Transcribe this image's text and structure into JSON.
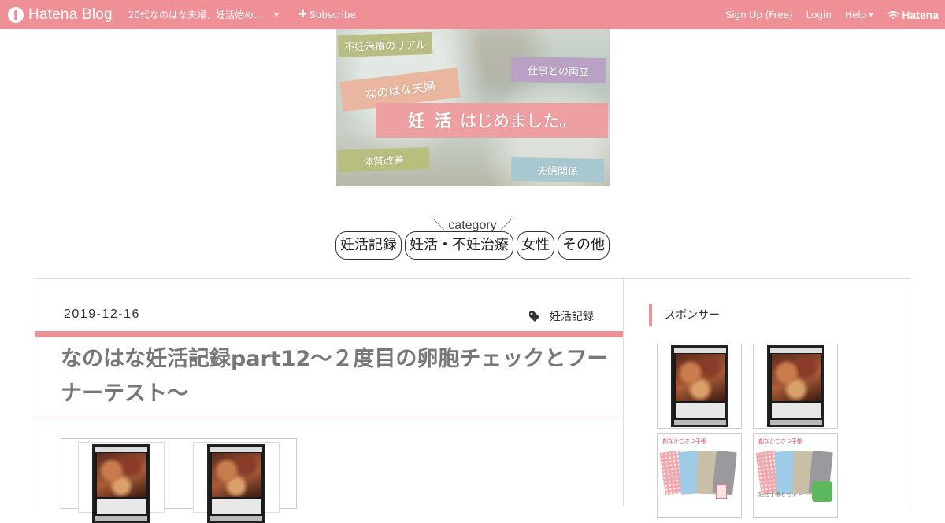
{
  "topbar": {
    "brand": "Hatena Blog",
    "blog_name": "20代なのはな夫婦、妊活始め…",
    "subscribe": "Subscribe",
    "signup": "Sign Up (Free)",
    "login": "Login",
    "help": "Help",
    "hatena": "Hatena",
    "bg_color": "#ef8f96"
  },
  "banner": {
    "tape1": "不妊治療のリアル",
    "tape2": "仕事との両立",
    "tape3": "なのはな夫婦",
    "tape4_strong": "妊 活",
    "tape4_rest": "はじめました。",
    "tape5": "体質改善",
    "tape6": "夫婦関係"
  },
  "category": {
    "heading": "＼ category ／",
    "items": [
      "妊活記録",
      "妊活・不妊治療",
      "女性",
      "その他"
    ]
  },
  "post": {
    "date": "2019-12-16",
    "category": "妊活記録",
    "title": "なのはな妊活記録part12～２度目の卵胞チェックとフーナーテスト～"
  },
  "sidebar": {
    "heading": "スポンサー",
    "sleeve_label": "創なかこさつ手帳",
    "sleeve_caption": "妊活手帳とセット"
  }
}
